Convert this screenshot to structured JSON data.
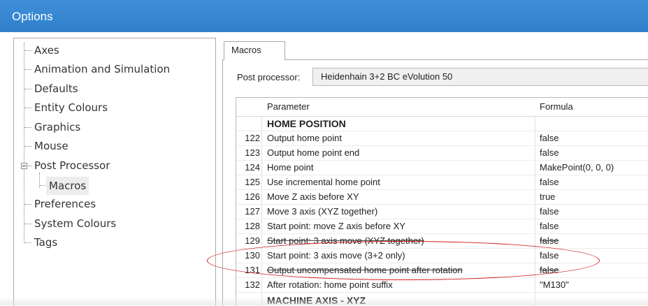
{
  "window": {
    "title": "Options"
  },
  "tree": {
    "items": [
      {
        "label": "Axes"
      },
      {
        "label": "Animation and Simulation"
      },
      {
        "label": "Defaults"
      },
      {
        "label": "Entity Colours"
      },
      {
        "label": "Graphics"
      },
      {
        "label": "Mouse"
      },
      {
        "label": "Post Processor"
      },
      {
        "label": "Macros"
      },
      {
        "label": "Preferences"
      },
      {
        "label": "System Colours"
      },
      {
        "label": "Tags"
      }
    ]
  },
  "tabs": [
    {
      "label": "Macros"
    }
  ],
  "post_processor": {
    "label": "Post processor:",
    "value": "Heidenhain 3+2 BC eVolution 50"
  },
  "grid": {
    "headers": {
      "parameter": "Parameter",
      "formula": "Formula"
    },
    "rows": [
      {
        "num": "",
        "parameter": "HOME POSITION",
        "formula": "",
        "section": true
      },
      {
        "num": "122",
        "parameter": "Output home point",
        "formula": "false"
      },
      {
        "num": "123",
        "parameter": "Output home point end",
        "formula": "false"
      },
      {
        "num": "124",
        "parameter": "Home point",
        "formula": "MakePoint(0, 0, 0)"
      },
      {
        "num": "125",
        "parameter": "Use incremental home point",
        "formula": "false"
      },
      {
        "num": "126",
        "parameter": "Move Z axis before XY",
        "formula": "true"
      },
      {
        "num": "127",
        "parameter": "Move 3 axis (XYZ together)",
        "formula": "false"
      },
      {
        "num": "128",
        "parameter": "Start point: move Z axis before XY",
        "formula": "false"
      },
      {
        "num": "129",
        "parameter": "Start point: 3 axis move (XYZ together)",
        "formula": "false"
      },
      {
        "num": "130",
        "parameter": "Start point: 3 axis move (3+2 only)",
        "formula": "false"
      },
      {
        "num": "131",
        "parameter": "Output uncompensated home point after rotation",
        "formula": "false"
      },
      {
        "num": "132",
        "parameter": "After rotation: home point suffix",
        "formula": "\"M130\""
      },
      {
        "num": "",
        "parameter": "MACHINE AXIS - XYZ",
        "formula": "",
        "section": true
      }
    ]
  },
  "colors": {
    "titlebar": "#3f8fd8",
    "highlight_ellipse": "#d21e1e"
  }
}
